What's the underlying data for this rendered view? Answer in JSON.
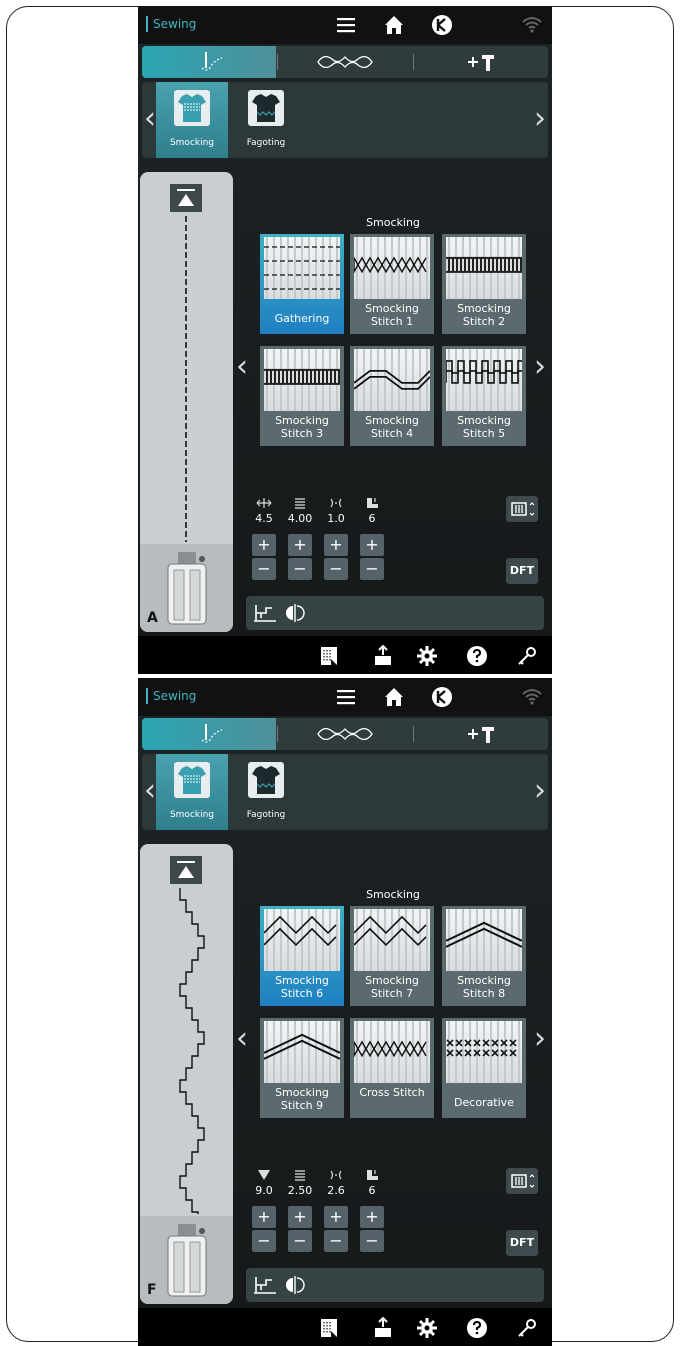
{
  "screens": [
    {
      "id": "screen1",
      "header": {
        "app_title": "Sewing"
      },
      "categories": [
        {
          "label": "Smocking",
          "active": true
        },
        {
          "label": "Fagoting",
          "active": false
        }
      ],
      "section_title": "Smocking",
      "stitches": [
        {
          "label": "Gathering",
          "active": true,
          "pattern": "gathering"
        },
        {
          "label": "Smocking Stitch 1",
          "active": false,
          "pattern": "diamond"
        },
        {
          "label": "Smocking Stitch 2",
          "active": false,
          "pattern": "band"
        },
        {
          "label": "Smocking Stitch 3",
          "active": false,
          "pattern": "band"
        },
        {
          "label": "Smocking Stitch 4",
          "active": false,
          "pattern": "wave"
        },
        {
          "label": "Smocking Stitch 5",
          "active": false,
          "pattern": "castle"
        }
      ],
      "params": [
        {
          "icon": "stitch-width-icon",
          "value": "4.5"
        },
        {
          "icon": "stitch-length-icon",
          "value": "4.00"
        },
        {
          "icon": "tension-icon",
          "value": "1.0"
        },
        {
          "icon": "presser-foot-pressure-icon",
          "value": "6"
        }
      ],
      "dft_label": "DFT",
      "presser_foot": "A"
    },
    {
      "id": "screen2",
      "header": {
        "app_title": "Sewing"
      },
      "categories": [
        {
          "label": "Smocking",
          "active": true
        },
        {
          "label": "Fagoting",
          "active": false
        }
      ],
      "section_title": "Smocking",
      "stitches": [
        {
          "label": "Smocking Stitch 6",
          "active": true,
          "pattern": "zigzag"
        },
        {
          "label": "Smocking Stitch 7",
          "active": false,
          "pattern": "zigzag"
        },
        {
          "label": "Smocking Stitch 8",
          "active": false,
          "pattern": "chevron"
        },
        {
          "label": "Smocking Stitch 9",
          "active": false,
          "pattern": "chevron"
        },
        {
          "label": "Cross Stitch",
          "active": false,
          "pattern": "diamond"
        },
        {
          "label": "Decorative",
          "active": false,
          "pattern": "cross"
        }
      ],
      "params": [
        {
          "icon": "stitch-density-icon",
          "value": "9.0"
        },
        {
          "icon": "stitch-length-icon",
          "value": "2.50"
        },
        {
          "icon": "tension-icon",
          "value": "2.6"
        },
        {
          "icon": "presser-foot-pressure-icon",
          "value": "6"
        }
      ],
      "dft_label": "DFT",
      "presser_foot": "F"
    }
  ],
  "colors": {
    "accent": "#3fb8c2",
    "active_tile": "#1f7fc2",
    "inactive_tile": "#5b6a6e",
    "background": "#1a1f21"
  }
}
